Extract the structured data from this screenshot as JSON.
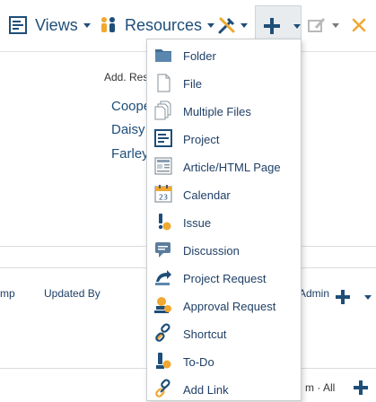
{
  "toolbar": {
    "views_label": "Views",
    "resources_label": "Resources"
  },
  "background": {
    "add_resource": "Add. Res",
    "names": [
      "Coope",
      "Daisy",
      "Farley"
    ],
    "col_emp": "mp",
    "col_updated_by": "Updated By",
    "col_admin": "Admin",
    "footer_text": "m · All"
  },
  "menu": {
    "items": [
      {
        "label": "Folder",
        "icon": "folder-icon"
      },
      {
        "label": "File",
        "icon": "file-icon"
      },
      {
        "label": "Multiple Files",
        "icon": "multiple-files-icon"
      },
      {
        "label": "Project",
        "icon": "project-icon"
      },
      {
        "label": "Article/HTML Page",
        "icon": "article-icon"
      },
      {
        "label": "Calendar",
        "icon": "calendar-icon"
      },
      {
        "label": "Issue",
        "icon": "issue-icon"
      },
      {
        "label": "Discussion",
        "icon": "discussion-icon"
      },
      {
        "label": "Project Request",
        "icon": "project-request-icon"
      },
      {
        "label": "Approval Request",
        "icon": "approval-request-icon"
      },
      {
        "label": "Shortcut",
        "icon": "shortcut-icon"
      },
      {
        "label": "To-Do",
        "icon": "todo-icon"
      },
      {
        "label": "Add Link",
        "icon": "add-link-icon"
      }
    ]
  },
  "colors": {
    "brand_blue": "#1f4e79",
    "accent_orange": "#f0a830"
  }
}
